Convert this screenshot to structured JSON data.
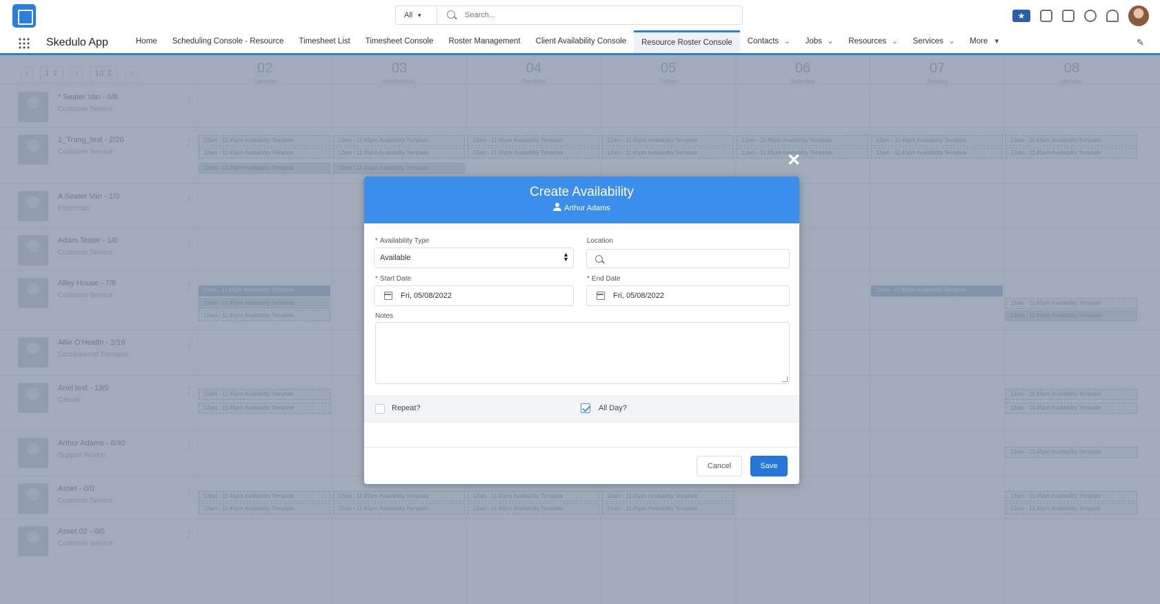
{
  "search": {
    "scope": "All",
    "placeholder": "Search..."
  },
  "header": {
    "app_name": "Skedulo App"
  },
  "nav": {
    "items": [
      {
        "label": "Home",
        "has_dropdown": false,
        "active": false
      },
      {
        "label": "Scheduling Console - Resource",
        "has_dropdown": false,
        "active": false
      },
      {
        "label": "Timesheet List",
        "has_dropdown": false,
        "active": false
      },
      {
        "label": "Timesheet Console",
        "has_dropdown": false,
        "active": false
      },
      {
        "label": "Roster Management",
        "has_dropdown": false,
        "active": false
      },
      {
        "label": "Client Availability Console",
        "has_dropdown": false,
        "active": false
      },
      {
        "label": "Resource Roster Console",
        "has_dropdown": false,
        "active": true
      },
      {
        "label": "Contacts",
        "has_dropdown": true,
        "active": false
      },
      {
        "label": "Jobs",
        "has_dropdown": true,
        "active": false
      },
      {
        "label": "Resources",
        "has_dropdown": true,
        "active": false
      },
      {
        "label": "Services",
        "has_dropdown": true,
        "active": false
      },
      {
        "label": "More",
        "has_dropdown": true,
        "active": false
      }
    ]
  },
  "calendar": {
    "days": [
      {
        "num": "02",
        "name": "Tuesday"
      },
      {
        "num": "03",
        "name": "Wednesday"
      },
      {
        "num": "04",
        "name": "Thursday"
      },
      {
        "num": "05",
        "name": "Friday"
      },
      {
        "num": "06",
        "name": "Saturday"
      },
      {
        "num": "07",
        "name": "Sunday"
      },
      {
        "num": "08",
        "name": "Monday"
      }
    ],
    "resources": [
      {
        "name": "* Seater Van - 0/8",
        "sub": "Customer Service"
      },
      {
        "name": "1_Trang_test - 2/20",
        "sub": "Customer Service"
      },
      {
        "name": "A Seater Van - 1/0",
        "sub": "Electrician"
      },
      {
        "name": "Adam Tester - 1/0",
        "sub": "Customer Service"
      },
      {
        "name": "Alley House - 7/8",
        "sub": "Customer Service"
      },
      {
        "name": "Allie O'Health - 2/16",
        "sub": "Occupational Therapist"
      },
      {
        "name": "Ariel test - 13/0",
        "sub": "Casual"
      },
      {
        "name": "Arthur Adams - 8/40",
        "sub": "Support Worker"
      },
      {
        "name": "Asset - 0/0",
        "sub": "Customer Service"
      },
      {
        "name": "Asset 02 - 0/0",
        "sub": "Customer Service"
      }
    ],
    "event_text": "12am - 11:45pm Availability Template"
  },
  "modal": {
    "title": "Create Availability",
    "subtitle": "Arthur Adams",
    "availability_type_label": "Availability Type",
    "availability_type_value": "Available",
    "location_label": "Location",
    "start_date_label": "Start Date",
    "start_date_value": "Fri, 05/08/2022",
    "end_date_label": "End Date",
    "end_date_value": "Fri, 05/08/2022",
    "notes_label": "Notes",
    "repeat_label": "Repeat?",
    "repeat_checked": false,
    "all_day_label": "All Day?",
    "all_day_checked": true,
    "cancel_label": "Cancel",
    "save_label": "Save"
  },
  "colors": {
    "accent": "#2b7fdc",
    "modal_header": "#3b8eea",
    "save_button": "#2378d9"
  }
}
